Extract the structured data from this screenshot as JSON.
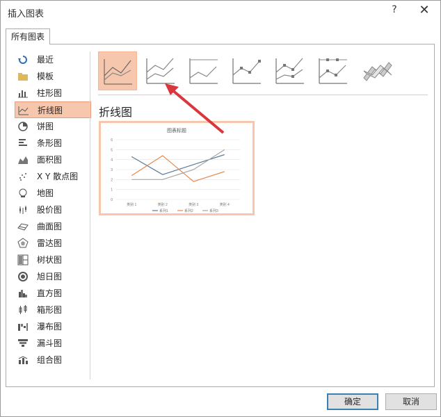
{
  "window": {
    "title": "插入图表",
    "help": "?",
    "close": "✕"
  },
  "tab": {
    "label": "所有图表"
  },
  "categories": [
    {
      "label": "最近",
      "icon": "recent-icon"
    },
    {
      "label": "模板",
      "icon": "folder-icon"
    },
    {
      "label": "柱形图",
      "icon": "column-chart-icon"
    },
    {
      "label": "折线图",
      "icon": "line-chart-icon",
      "selected": true
    },
    {
      "label": "饼图",
      "icon": "pie-chart-icon"
    },
    {
      "label": "条形图",
      "icon": "bar-chart-icon"
    },
    {
      "label": "面积图",
      "icon": "area-chart-icon"
    },
    {
      "label": "X Y 散点图",
      "icon": "scatter-chart-icon"
    },
    {
      "label": "地图",
      "icon": "map-chart-icon"
    },
    {
      "label": "股价图",
      "icon": "stock-chart-icon"
    },
    {
      "label": "曲面图",
      "icon": "surface-chart-icon"
    },
    {
      "label": "雷达图",
      "icon": "radar-chart-icon"
    },
    {
      "label": "树状图",
      "icon": "treemap-chart-icon"
    },
    {
      "label": "旭日图",
      "icon": "sunburst-chart-icon"
    },
    {
      "label": "直方图",
      "icon": "histogram-chart-icon"
    },
    {
      "label": "箱形图",
      "icon": "box-whisker-chart-icon"
    },
    {
      "label": "瀑布图",
      "icon": "waterfall-chart-icon"
    },
    {
      "label": "漏斗图",
      "icon": "funnel-chart-icon"
    },
    {
      "label": "组合图",
      "icon": "combo-chart-icon"
    }
  ],
  "section": {
    "title": "折线图"
  },
  "chart_data": {
    "type": "line",
    "title": "图表标题",
    "categories": [
      "类别 1",
      "类别 2",
      "类别 3",
      "类别 4"
    ],
    "series": [
      {
        "name": "系列1",
        "values": [
          4.3,
          2.5,
          3.5,
          4.5
        ],
        "color": "#5b7a9a"
      },
      {
        "name": "系列2",
        "values": [
          2.4,
          4.4,
          1.8,
          2.8
        ],
        "color": "#e3894f"
      },
      {
        "name": "系列3",
        "values": [
          2,
          2,
          3,
          5
        ],
        "color": "#a5a5a5"
      }
    ],
    "ylim": [
      0,
      6
    ],
    "yticks": [
      "0",
      "1",
      "2",
      "3",
      "4",
      "5",
      "6"
    ],
    "grid": true,
    "legend": "bottom"
  },
  "buttons": {
    "ok": "确定",
    "cancel": "取消"
  },
  "colors": {
    "accent_selected": "#f6c6ad",
    "arrow": "#d9363e"
  }
}
